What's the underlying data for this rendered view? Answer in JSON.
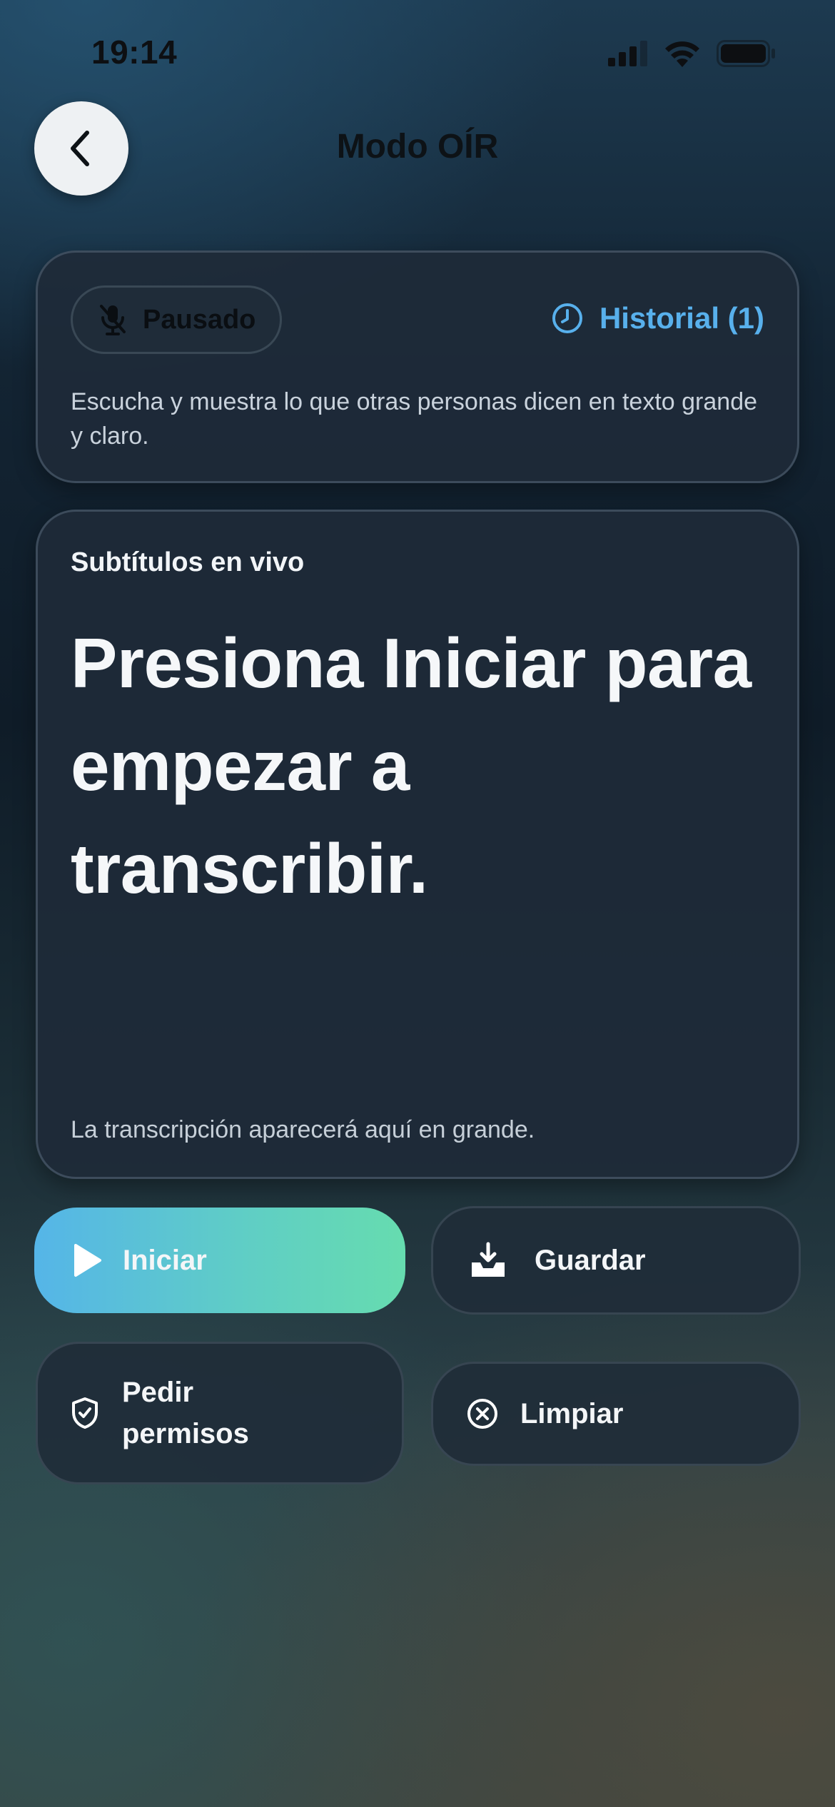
{
  "status_bar": {
    "time": "19:14"
  },
  "header": {
    "title": "Modo OÍR",
    "back_icon": "chevron-left-icon"
  },
  "status_card": {
    "status_pill": {
      "label": "Pausado",
      "icon": "mic-off-icon"
    },
    "history": {
      "label": "Historial (1)",
      "icon": "clock-icon",
      "color": "#58b0ec"
    },
    "description": "Escucha y muestra lo que otras personas dicen en texto grande y claro."
  },
  "live_card": {
    "title": "Subtítulos en vivo",
    "text": "Presiona Iniciar para empezar a transcribir.",
    "hint": "La transcripción aparecerá aquí en grande."
  },
  "actions": {
    "start": {
      "label": "Iniciar",
      "icon": "play-icon",
      "gradient": [
        "#55b5e8",
        "#66dcaf"
      ]
    },
    "save": {
      "label": "Guardar",
      "icon": "download-tray-icon"
    },
    "permissions": {
      "label": "Pedir permisos",
      "icon": "shield-check-icon"
    },
    "clear": {
      "label": "Limpiar",
      "icon": "x-circle-icon"
    }
  }
}
